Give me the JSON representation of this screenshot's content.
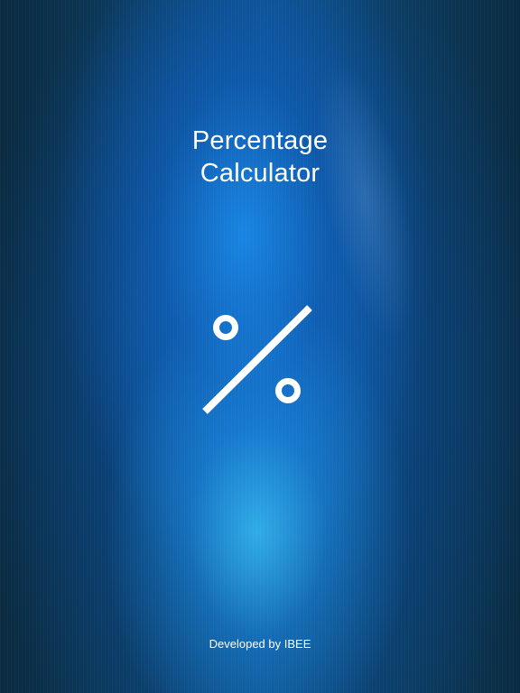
{
  "app": {
    "title_line1": "Percentage",
    "title_line2": "Calculator",
    "logo_icon": "percent-icon",
    "developer_credit": "Developed by IBEE"
  },
  "colors": {
    "text": "#ffffff",
    "background_dark": "#0b2f4a",
    "background_glow": "#1e88e5",
    "icon": "#ffffff"
  }
}
